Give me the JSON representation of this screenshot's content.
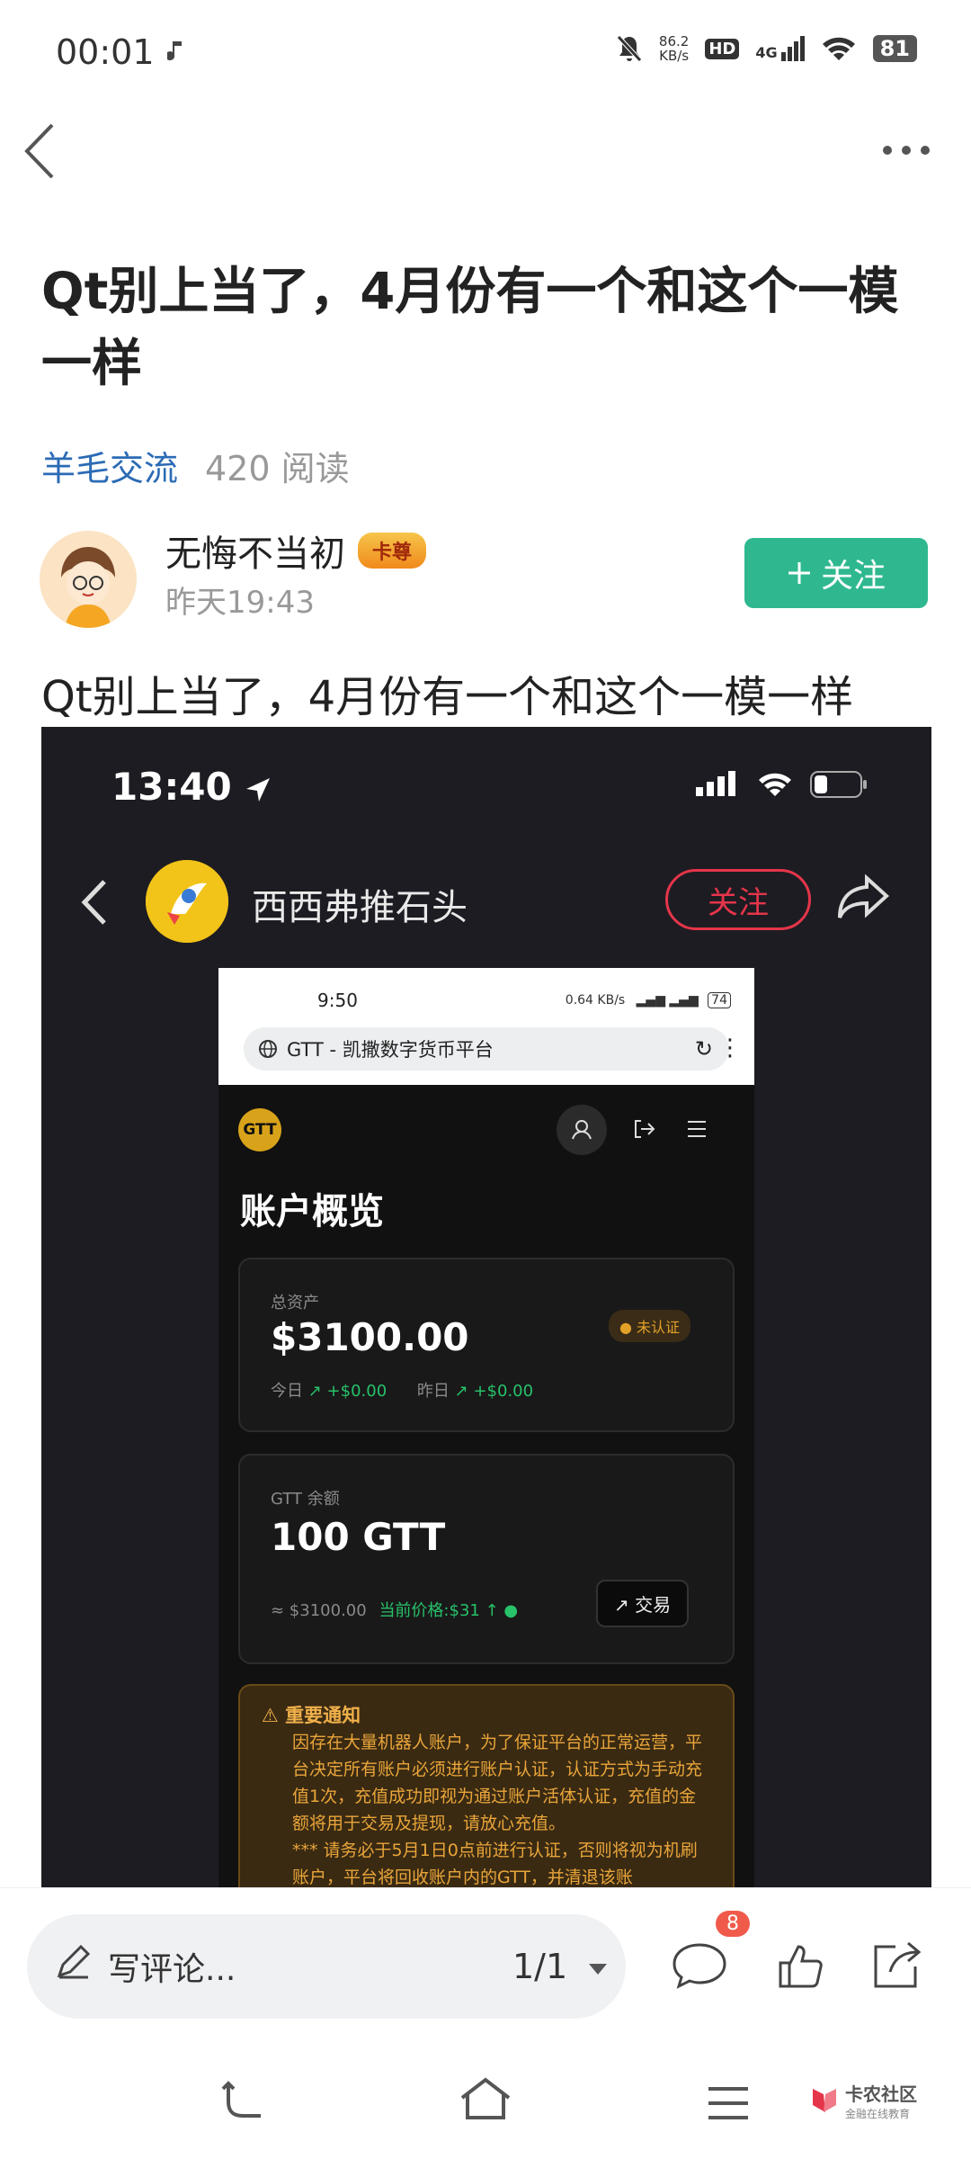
{
  "status_bar": {
    "time": "00:01",
    "net_speed_value": "86.2",
    "net_speed_unit": "KB/s",
    "hd": "HD",
    "signal": "4G",
    "battery": "81"
  },
  "post": {
    "title": "Qt别上当了，4月份有一个和这个一模一样",
    "category": "羊毛交流",
    "reads": "420 阅读",
    "author": "无悔不当初",
    "badge": "卡尊",
    "time": "昨天19:43",
    "follow_label": "关注",
    "body": "Qt别上当了，4月份有一个和这个一模一样"
  },
  "embedded": {
    "time": "13:40",
    "channel_name": "西西弗推石头",
    "follow_label": "关注",
    "phone": {
      "time": "9:50",
      "status": "0.64 KB/s",
      "battery": "74",
      "url": "GTT - 凯撒数字货币平台",
      "logo": "GTT",
      "page_title": "账户概览",
      "total_assets_label": "总资产",
      "total_assets": "$3100.00",
      "unverified": "未认证",
      "today_label": "今日",
      "today_value": "+$0.00",
      "yesterday_label": "昨日",
      "yesterday_value": "+$0.00",
      "balance_label": "GTT 余额",
      "balance": "100 GTT",
      "approx": "≈ $3100.00",
      "price": "当前价格:$31 ↑",
      "trade_label": "交易",
      "notice_title": "重要通知",
      "notice_text": "因存在大量机器人账户，为了保证平台的正常运营，平台决定所有账户必须进行账户认证，认证方式为手动充值1次，充值成功即视为通过账户活体认证，充值的金额将用于交易及提现，请放心充值。",
      "notice_text2": "*** 请务必于5月1日0点前进行认证，否则将视为机刷账户，平台将回收账户内的GTT，并清退该账"
    }
  },
  "bottom": {
    "comment_placeholder": "写评论...",
    "page": "1/1",
    "comment_count": "8"
  },
  "nav": {
    "watermark_title": "卡农社区",
    "watermark_sub": "金融在线教育"
  },
  "colors": {
    "accent": "#2fb88f",
    "link": "#2b6bb5",
    "follow_red": "#e5354a"
  }
}
